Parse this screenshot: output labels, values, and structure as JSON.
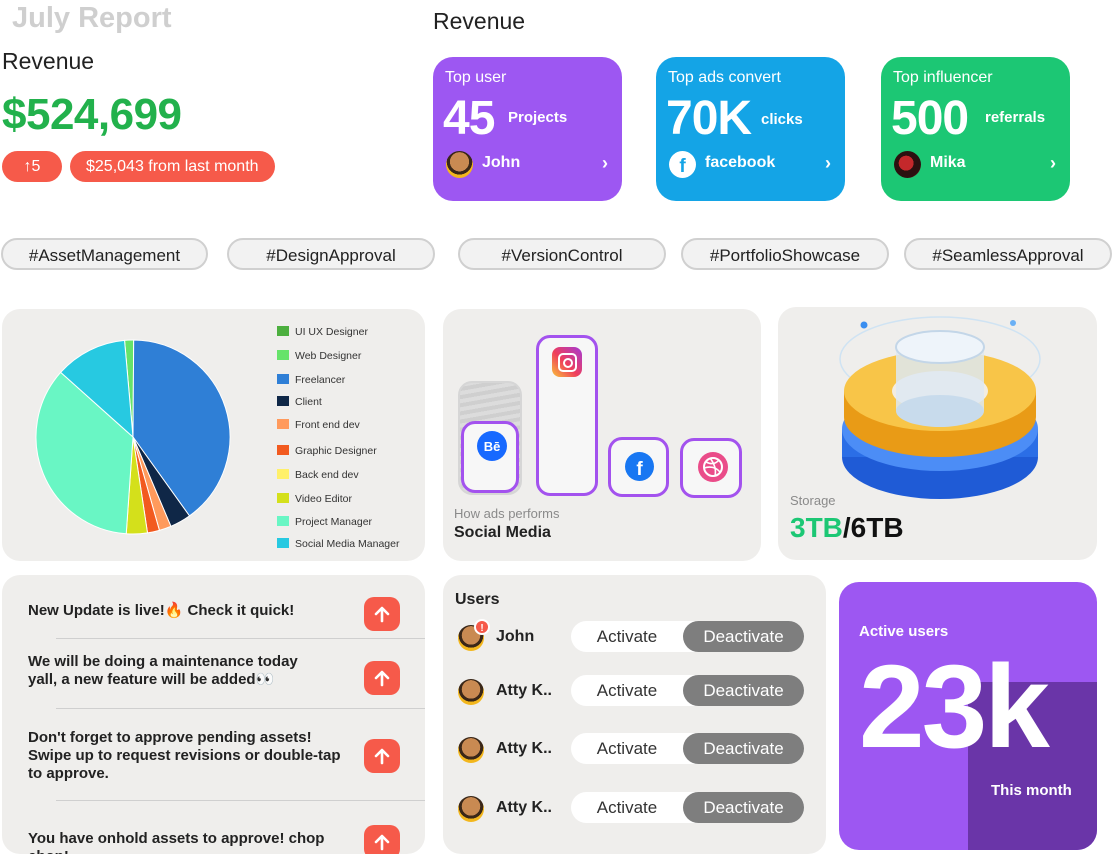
{
  "header": {
    "title": "July Report",
    "revenue_label": "Revenue",
    "revenue_amount": "$524,699",
    "growth_badge": "↑5",
    "from_last_month": "$25,043 from last month"
  },
  "revenue_section": {
    "title": "Revenue",
    "cards": [
      {
        "label": "Top user",
        "value": "45",
        "unit": "Projects",
        "person": "John",
        "color": "#9d57f2"
      },
      {
        "label": "Top ads convert",
        "value": "70K",
        "unit": "clicks",
        "person": "facebook",
        "color": "#14a4e6"
      },
      {
        "label": "Top influencer",
        "value": "500",
        "unit": "referrals",
        "person": "Mika",
        "color": "#1cc774"
      }
    ]
  },
  "tags": [
    "#AssetManagement",
    "#DesignApproval",
    "#VersionControl",
    "#PortfolioShowcase",
    "#SeamlessApproval"
  ],
  "chart_data": {
    "type": "pie",
    "categories": [
      "UI UX Designer",
      "Web Designer",
      "Freelancer",
      "Client",
      "Front end dev",
      "Graphic Designer",
      "Back end dev",
      "Video Editor",
      "Project Manager",
      "Social Media Manager"
    ],
    "values": [
      0,
      1.5,
      40,
      3.5,
      2,
      2,
      0,
      3.5,
      35.5,
      12
    ],
    "colors": [
      "#4caf3f",
      "#66e36a",
      "#2f7fd6",
      "#0f2747",
      "#ff9a5c",
      "#f25a1f",
      "#fff06a",
      "#d4e01b",
      "#69f6c4",
      "#27c9e1"
    ]
  },
  "social": {
    "caption": "How ads performs",
    "title": "Social Media"
  },
  "storage": {
    "label": "Storage",
    "used": "3TB",
    "total": "/6TB"
  },
  "notifications": [
    {
      "text": "New Update is live!🔥 Check it quick!"
    },
    {
      "text": "We will be doing a maintenance today yall, a new feature will be added👀"
    },
    {
      "text": "Don't forget to approve pending assets! Swipe up to request revisions or double-tap to approve."
    },
    {
      "text": "You have onhold assets to approve! chop chop!"
    }
  ],
  "users": {
    "title": "Users",
    "activate_label": "Activate",
    "deactivate_label": "Deactivate",
    "rows": [
      {
        "name": "John",
        "alert": "!"
      },
      {
        "name": "Atty K.."
      },
      {
        "name": "Atty K.."
      },
      {
        "name": "Atty K.."
      }
    ]
  },
  "active_users": {
    "label": "Active users",
    "value": "23k",
    "period": "This month"
  }
}
